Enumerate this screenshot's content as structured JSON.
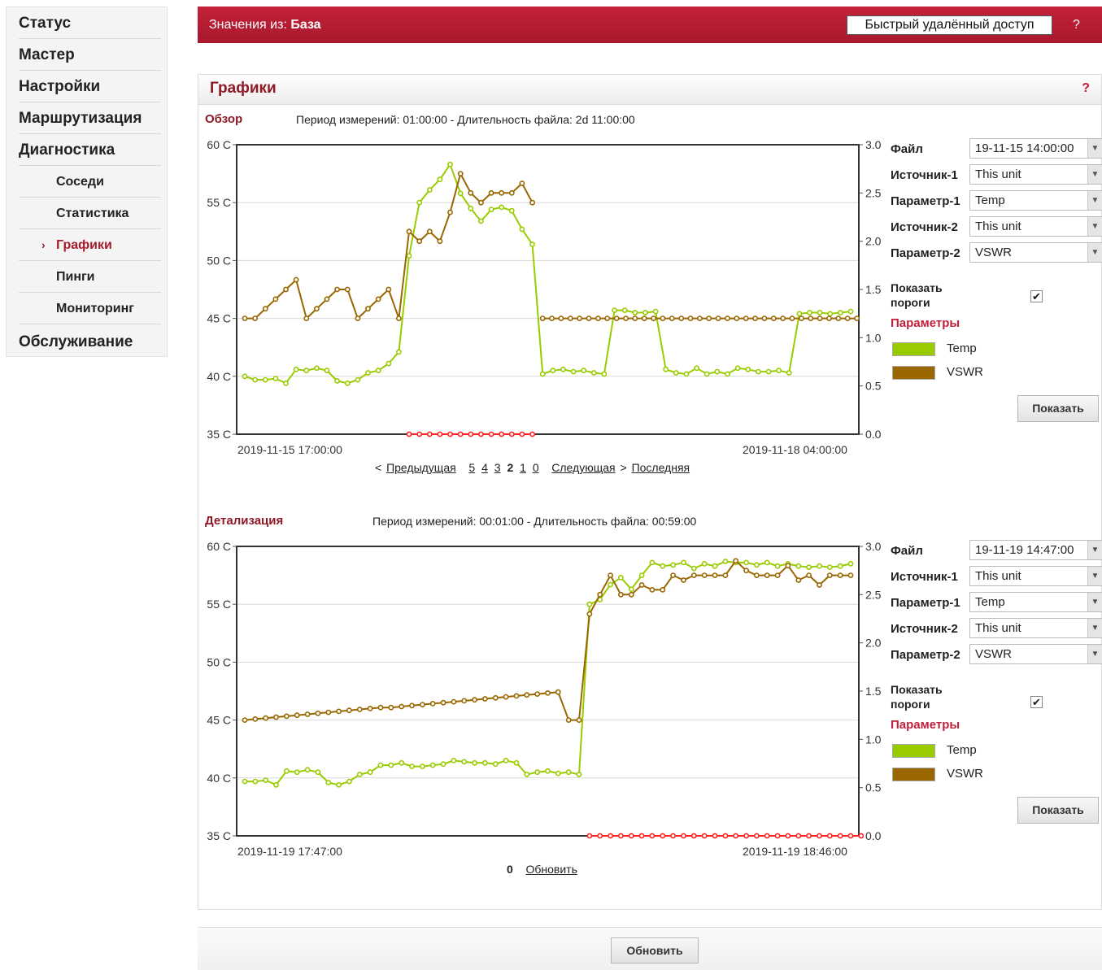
{
  "sidebar": {
    "items": [
      {
        "label": "Статус"
      },
      {
        "label": "Мастер"
      },
      {
        "label": "Настройки"
      },
      {
        "label": "Маршрутизация"
      },
      {
        "label": "Диагностика"
      },
      {
        "label": "Обслуживание"
      }
    ],
    "sub_items": [
      {
        "label": "Соседи"
      },
      {
        "label": "Статистика"
      },
      {
        "label": "Графики",
        "active": true,
        "marker": "›"
      },
      {
        "label": "Пинги"
      },
      {
        "label": "Мониторинг"
      }
    ]
  },
  "header": {
    "source_prefix": "Значения из:",
    "source_value": "База",
    "remote_button": "Быстрый удалённый доступ",
    "help": "?"
  },
  "panel": {
    "title": "Графики",
    "help": "?"
  },
  "overview": {
    "title": "Обзор",
    "info": "Период измерений: 01:00:00  -  Длительность файла: 2d 11:00:00",
    "date_start": "2019-11-15 17:00:00",
    "date_end": "2019-11-18 04:00:00",
    "pager": {
      "prev": "Предыдущая",
      "prev_prefix": "<",
      "pages": [
        "5",
        "4",
        "3"
      ],
      "current": "2",
      "pages_after": [
        "1",
        "0"
      ],
      "next": "Следующая",
      "next_suffix": ">",
      "last": "Последняя"
    },
    "form": {
      "file_label": "Файл",
      "file_value": "19-11-15 14:00:00",
      "source1_label": "Источник-1",
      "source1_value": "This unit",
      "param1_label": "Параметр-1",
      "param1_value": "Temp",
      "source2_label": "Источник-2",
      "source2_value": "This unit",
      "param2_label": "Параметр-2",
      "param2_value": "VSWR",
      "thresholds_line1": "Показать",
      "thresholds_line2": "пороги",
      "thresholds_checked": "✔",
      "params_label": "Параметры",
      "legend": [
        {
          "name": "Temp",
          "color": "#99cc00"
        },
        {
          "name": "VSWR",
          "color": "#996600"
        }
      ],
      "show_button": "Показать"
    }
  },
  "detail": {
    "title": "Детализация",
    "info": "Период измерений: 00:01:00  -  Длительность файла: 00:59:00",
    "date_start": "2019-11-19 17:47:00",
    "date_end": "2019-11-19 18:46:00",
    "pager": {
      "current": "0",
      "refresh": "Обновить"
    },
    "form": {
      "file_label": "Файл",
      "file_value": "19-11-19 14:47:00",
      "source1_label": "Источник-1",
      "source1_value": "This unit",
      "param1_label": "Параметр-1",
      "param1_value": "Temp",
      "source2_label": "Источник-2",
      "source2_value": "This unit",
      "param2_label": "Параметр-2",
      "param2_value": "VSWR",
      "thresholds_line1": "Показать",
      "thresholds_line2": "пороги",
      "thresholds_checked": "✔",
      "params_label": "Параметры",
      "legend": [
        {
          "name": "Temp",
          "color": "#99cc00"
        },
        {
          "name": "VSWR",
          "color": "#996600"
        }
      ],
      "show_button": "Показать"
    }
  },
  "footer": {
    "refresh_button": "Обновить"
  },
  "chart_data": [
    {
      "type": "line",
      "left_ticks": [
        "60 C",
        "55 C",
        "50 C",
        "45 C",
        "40 C",
        "35 C"
      ],
      "right_ticks": [
        "3.0",
        "2.5",
        "2.0",
        "1.5",
        "1.0",
        "0.5",
        "0.0"
      ],
      "ylim_left": [
        35,
        60
      ],
      "ylim_right": [
        0,
        3
      ],
      "series": [
        {
          "name": "Temp",
          "color": "#99cc00",
          "axis": "left",
          "values": [
            40.0,
            39.7,
            39.7,
            39.8,
            39.4,
            40.6,
            40.5,
            40.7,
            40.5,
            39.6,
            39.4,
            39.7,
            40.3,
            40.5,
            41.1,
            42.1,
            50.4,
            55.0,
            56.1,
            57.0,
            58.3,
            55.8,
            54.5,
            53.4,
            54.4,
            54.6,
            54.3,
            52.7,
            51.4,
            40.2,
            40.5,
            40.6,
            40.4,
            40.5,
            40.3,
            40.2,
            45.7,
            45.7,
            45.5,
            45.5,
            45.6,
            40.6,
            40.3,
            40.2,
            40.7,
            40.2,
            40.4,
            40.2,
            40.7,
            40.6,
            40.4,
            40.4,
            40.5,
            40.3,
            45.4,
            45.5,
            45.5,
            45.4,
            45.5,
            45.6
          ],
          "x_start": 0.0,
          "x_step": 1.0
        },
        {
          "name": "VSWR",
          "color": "#996600",
          "axis": "right",
          "values": [
            1.2,
            1.2,
            1.3,
            1.4,
            1.5,
            1.6,
            1.2,
            1.3,
            1.4,
            1.5,
            1.5,
            1.2,
            1.3,
            1.4,
            1.5,
            1.2,
            2.1,
            2.0,
            2.1,
            2.0,
            2.3,
            2.7,
            2.5,
            2.4,
            2.5,
            2.5,
            2.5,
            2.6,
            2.4
          ],
          "x_start": 0.0,
          "x_step": 1.0
        },
        {
          "name": "VSWR",
          "color": "#996600",
          "axis": "right",
          "values": [
            1.2,
            1.2,
            1.2,
            1.2,
            1.2,
            1.2,
            1.2,
            1.2,
            1.2,
            1.2,
            1.2,
            1.2,
            1.2,
            1.2,
            1.2,
            1.2,
            1.2,
            1.2,
            1.2,
            1.2,
            1.2,
            1.2,
            1.2,
            1.2,
            1.2,
            1.2,
            1.2,
            1.2,
            1.2,
            1.2,
            1.2,
            1.2,
            1.2,
            1.2,
            1.2
          ],
          "x_start": 29.0,
          "x_step": 0.9
        },
        {
          "name": "threshold",
          "color": "#ff2222",
          "axis": "right",
          "values": [
            0.0,
            0.0,
            0.0,
            0.0,
            0.0,
            0.0,
            0.0,
            0.0,
            0.0,
            0.0,
            0.0,
            0.0,
            0.0
          ],
          "x_start": 16.0,
          "x_step": 1.0
        }
      ],
      "xlim": [
        0,
        59
      ]
    },
    {
      "type": "line",
      "left_ticks": [
        "60 C",
        "55 C",
        "50 C",
        "45 C",
        "40 C",
        "35 C"
      ],
      "right_ticks": [
        "3.0",
        "2.5",
        "2.0",
        "1.5",
        "1.0",
        "0.5",
        "0.0"
      ],
      "ylim_left": [
        35,
        60
      ],
      "ylim_right": [
        0,
        3
      ],
      "series": [
        {
          "name": "Temp",
          "color": "#99cc00",
          "axis": "left",
          "values": [
            39.7,
            39.7,
            39.8,
            39.4,
            40.6,
            40.5,
            40.7,
            40.5,
            39.6,
            39.4,
            39.7,
            40.3,
            40.5,
            41.1,
            41.1,
            41.3,
            41.0,
            41.0,
            41.1,
            41.2,
            41.5,
            41.4,
            41.3,
            41.3,
            41.2,
            41.5,
            41.3,
            40.3,
            40.5,
            40.6,
            40.4,
            40.5,
            40.3,
            55.0,
            55.4,
            56.7,
            57.3,
            56.3,
            57.5,
            58.6,
            58.3,
            58.4,
            58.6,
            58.1,
            58.5,
            58.3,
            58.7,
            58.6,
            58.6,
            58.4,
            58.6,
            58.3,
            58.5,
            58.3,
            58.2,
            58.3,
            58.2,
            58.3,
            58.5
          ],
          "x_start": 0.0,
          "x_step": 1.0
        },
        {
          "name": "VSWR",
          "color": "#996600",
          "axis": "right",
          "values": [
            1.2,
            1.21,
            1.22,
            1.23,
            1.24,
            1.25,
            1.26,
            1.27,
            1.28,
            1.29,
            1.3,
            1.31,
            1.32,
            1.33,
            1.33,
            1.34,
            1.35,
            1.36,
            1.37,
            1.38,
            1.39,
            1.4,
            1.41,
            1.42,
            1.43,
            1.44,
            1.45,
            1.46,
            1.47,
            1.48,
            1.49,
            1.2,
            1.2,
            2.3,
            2.5,
            2.7,
            2.5,
            2.5,
            2.6,
            2.55,
            2.55,
            2.7,
            2.65,
            2.7,
            2.7,
            2.7,
            2.7,
            2.85,
            2.75,
            2.7,
            2.7,
            2.7,
            2.8,
            2.65,
            2.7,
            2.6,
            2.7,
            2.7,
            2.7
          ],
          "x_start": 0.0,
          "x_step": 1.0
        },
        {
          "name": "threshold",
          "color": "#ff2222",
          "axis": "right",
          "values": [
            0.0,
            0.0,
            0.0,
            0.0,
            0.0,
            0.0,
            0.0,
            0.0,
            0.0,
            0.0,
            0.0,
            0.0,
            0.0,
            0.0,
            0.0,
            0.0,
            0.0,
            0.0,
            0.0,
            0.0,
            0.0,
            0.0,
            0.0,
            0.0,
            0.0,
            0.0,
            0.0
          ],
          "x_start": 33.0,
          "x_step": 1.0
        }
      ],
      "xlim": [
        0,
        58
      ]
    }
  ]
}
